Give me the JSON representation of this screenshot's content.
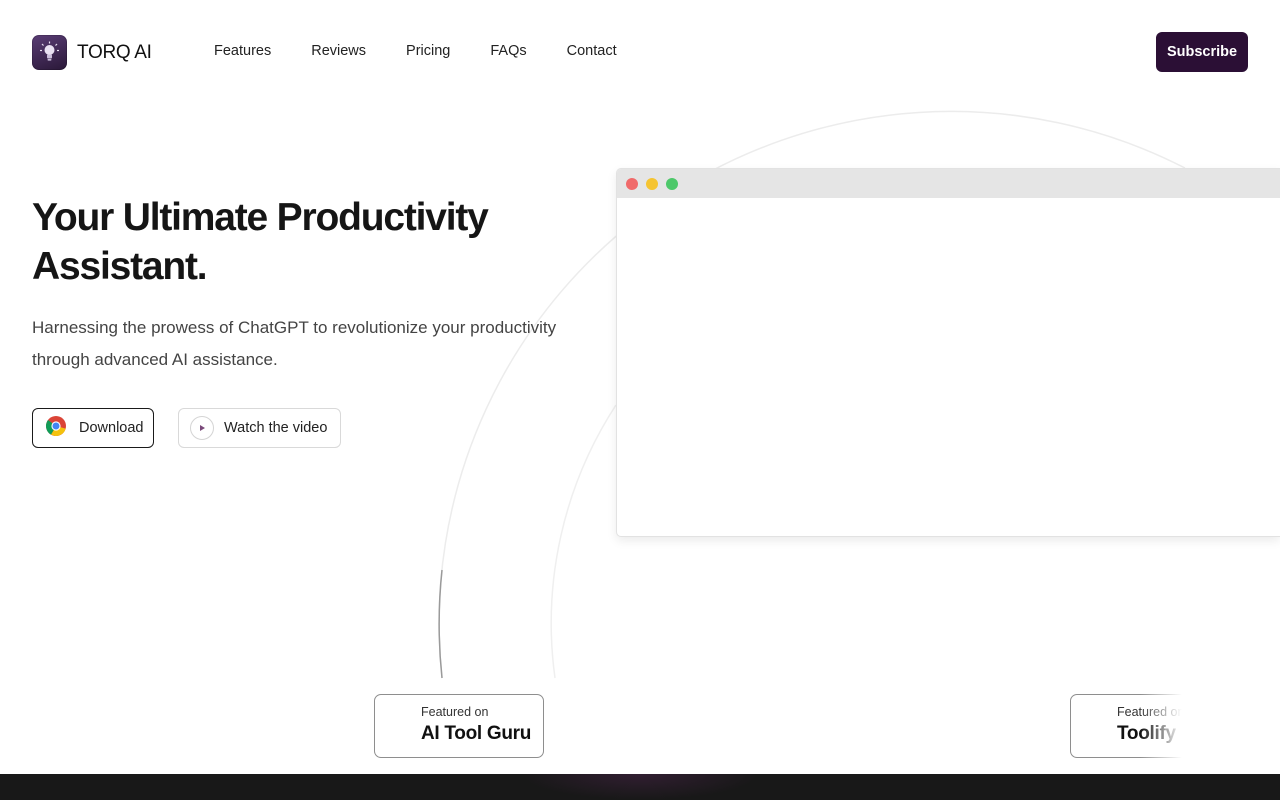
{
  "brand": {
    "name": "TORQ AI",
    "logo_icon": "lightbulb-icon",
    "accent": "#2b0f35"
  },
  "nav": {
    "items": [
      {
        "label": "Features"
      },
      {
        "label": "Reviews"
      },
      {
        "label": "Pricing"
      },
      {
        "label": "FAQs"
      },
      {
        "label": "Contact"
      }
    ],
    "subscribe_label": "Subscribe"
  },
  "hero": {
    "title": "Your Ultimate Productivity Assistant.",
    "subtitle": "Harnessing the prowess of ChatGPT to revolutionize your productivity through advanced AI assistance.",
    "download_label": "Download",
    "download_icon": "chrome-icon",
    "video_label": "Watch the video",
    "video_icon": "play-icon"
  },
  "browser_mockup": {
    "dot_colors": [
      "#f06a6a",
      "#f5c431",
      "#4dc86a"
    ]
  },
  "featured": [
    {
      "small": "Featured on",
      "big": "AI Tool Guru"
    },
    {
      "small": "Featured on",
      "big": "Toolify"
    }
  ]
}
